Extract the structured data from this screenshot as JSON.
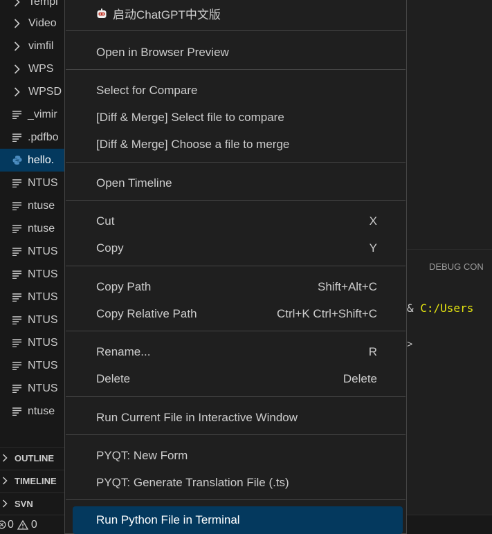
{
  "explorer": {
    "folders": [
      {
        "label": "Templ",
        "icon": "chevron-right-icon"
      },
      {
        "label": "Video",
        "icon": "chevron-right-icon"
      },
      {
        "label": "vimfil",
        "icon": "chevron-right-icon"
      },
      {
        "label": "WPS",
        "icon": "chevron-right-icon"
      },
      {
        "label": "WPSD",
        "icon": "chevron-right-icon"
      }
    ],
    "files": [
      {
        "label": "_vimir",
        "icon": "text-file-icon"
      },
      {
        "label": ".pdfbo",
        "icon": "text-file-icon"
      },
      {
        "label": "hello.",
        "icon": "python-file-icon",
        "selected": true
      },
      {
        "label": "NTUS",
        "icon": "text-file-icon"
      },
      {
        "label": "ntuse",
        "icon": "text-file-icon"
      },
      {
        "label": "ntuse",
        "icon": "text-file-icon"
      },
      {
        "label": "NTUS",
        "icon": "text-file-icon"
      },
      {
        "label": "NTUS",
        "icon": "text-file-icon"
      },
      {
        "label": "NTUS",
        "icon": "text-file-icon"
      },
      {
        "label": "NTUS",
        "icon": "text-file-icon"
      },
      {
        "label": "NTUS",
        "icon": "text-file-icon"
      },
      {
        "label": "NTUS",
        "icon": "text-file-icon"
      },
      {
        "label": "NTUS",
        "icon": "text-file-icon"
      },
      {
        "label": "ntuse",
        "icon": "text-file-icon"
      }
    ]
  },
  "panels": {
    "outline": "OUTLINE",
    "timeline": "TIMELINE",
    "svn": "SVN"
  },
  "status_bar": {
    "errors": "0",
    "warnings": "0"
  },
  "right_panel": {
    "debug_tab": "DEBUG CON",
    "terminal_prefix": "& ",
    "terminal_path": "C:/Users",
    "prompt_char": ">"
  },
  "context_menu": {
    "chatgpt": "启动ChatGPT中文版",
    "open_browser_preview": "Open in Browser Preview",
    "select_for_compare": "Select for Compare",
    "diff_select": "[Diff & Merge] Select file to compare",
    "diff_choose": "[Diff & Merge] Choose a file to merge",
    "open_timeline": "Open Timeline",
    "cut": {
      "label": "Cut",
      "key": "X"
    },
    "copy": {
      "label": "Copy",
      "key": "Y"
    },
    "copy_path": {
      "label": "Copy Path",
      "key": "Shift+Alt+C"
    },
    "copy_relative_path": {
      "label": "Copy Relative Path",
      "key": "Ctrl+K Ctrl+Shift+C"
    },
    "rename": {
      "label": "Rename...",
      "key": "R"
    },
    "delete": {
      "label": "Delete",
      "key": "Delete"
    },
    "run_interactive": "Run Current File in Interactive Window",
    "pyqt_new_form": "PYQT: New Form",
    "pyqt_translation": "PYQT: Generate Translation File (.ts)",
    "run_python_terminal": "Run Python File in Terminal"
  },
  "colors": {
    "selection": "#04395e",
    "menu_bg": "#1f1f1f",
    "python_icon": "#4b8bbe",
    "terminal_path": "#e5e510"
  }
}
